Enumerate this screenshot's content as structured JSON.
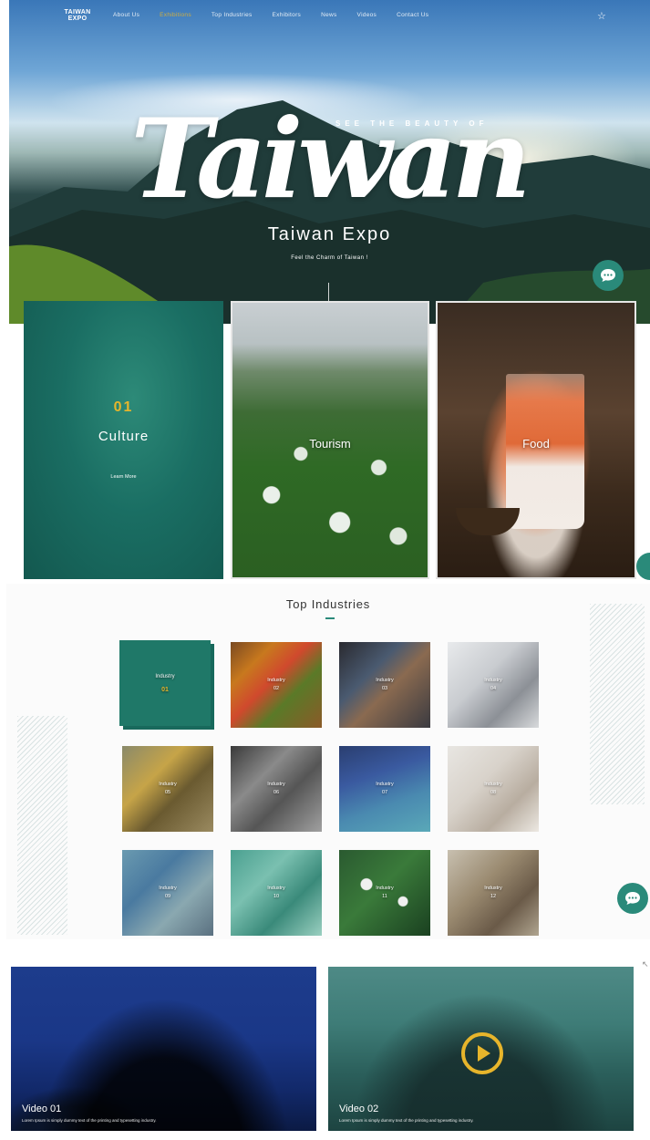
{
  "header": {
    "logo_line1": "TAIWAN",
    "logo_line2": "EXPO",
    "nav": [
      "About Us",
      "Exhibitions",
      "Top Industries",
      "Exhibitors",
      "News",
      "Videos",
      "Contact Us"
    ],
    "active_nav_index": 1,
    "icon": "star-icon"
  },
  "hero": {
    "tagline": "SEE THE BEAUTY OF",
    "script_title": "Taiwan",
    "title": "Taiwan Expo",
    "subtitle": "Feel the Charm of Taiwan !"
  },
  "cards": [
    {
      "num": "01",
      "title": "Culture",
      "link": "Learn More"
    },
    {
      "title": "Tourism"
    },
    {
      "title": "Food"
    }
  ],
  "industries": {
    "title": "Top Industries",
    "tiles": [
      {
        "label": "Industry",
        "num": "01"
      },
      {
        "label": "Industry",
        "num": "02"
      },
      {
        "label": "Industry",
        "num": "03"
      },
      {
        "label": "Industry",
        "num": "04"
      },
      {
        "label": "Industry",
        "num": "05"
      },
      {
        "label": "Industry",
        "num": "06"
      },
      {
        "label": "Industry",
        "num": "07"
      },
      {
        "label": "Industry",
        "num": "08"
      },
      {
        "label": "Industry",
        "num": "09"
      },
      {
        "label": "Industry",
        "num": "10"
      },
      {
        "label": "Industry",
        "num": "11"
      },
      {
        "label": "Industry",
        "num": "12"
      }
    ]
  },
  "videos": [
    {
      "title": "Video 01",
      "desc": "Lorem Ipsum is simply dummy text of the printing and typesetting industry."
    },
    {
      "title": "Video 02",
      "desc": "Lorem Ipsum is simply dummy text of the printing and typesetting industry."
    }
  ],
  "colors": {
    "accent": "#e7b52b",
    "teal": "#1f7868",
    "chat": "#2a8a7a"
  }
}
